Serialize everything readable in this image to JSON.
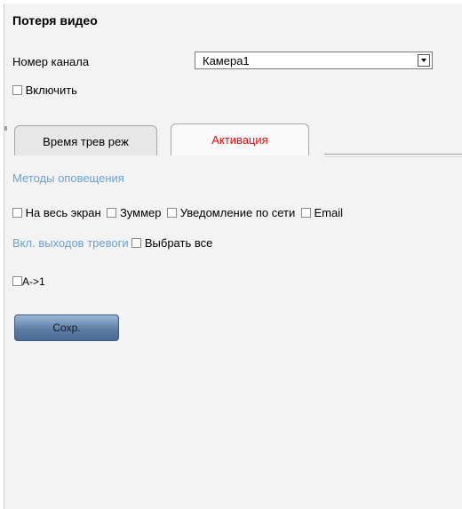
{
  "title": "Потеря видео",
  "channel": {
    "label": "Номер канала",
    "selected": "Камера1"
  },
  "enable": {
    "label": "Включить",
    "checked": false
  },
  "tabs": [
    {
      "label": "Время трев реж",
      "active": false
    },
    {
      "label": "Активация",
      "active": true,
      "color": "#ff0000"
    }
  ],
  "methods": {
    "heading": "Методы оповещения",
    "items": [
      {
        "label": "На весь экран",
        "checked": false
      },
      {
        "label": "Зуммер",
        "checked": false
      },
      {
        "label": "Уведомление по сети",
        "checked": false
      },
      {
        "label": "Email",
        "checked": false
      }
    ]
  },
  "alarm_outputs": {
    "heading": "Вкл. выходов тревоги",
    "select_all_label": "Выбрать все",
    "outputs": [
      {
        "label": "A->1",
        "checked": false
      }
    ]
  },
  "save_button": "Сохр.",
  "colors": {
    "section_heading": "#6aa2d6",
    "active_tab_text": "#ff0000",
    "button_blue": "#5d7fa6"
  }
}
